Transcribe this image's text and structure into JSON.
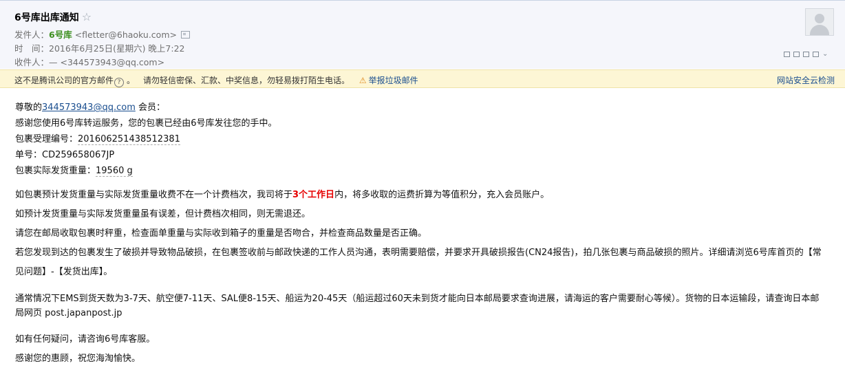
{
  "header": {
    "subject": "6号库出库通知",
    "star": "☆",
    "from_label": "发件人：",
    "from_name": "6号库",
    "from_email": "<fletter@6haoku.com>",
    "time_label": "时　间：",
    "time_value": "2016年6月25日(星期六) 晚上7:22",
    "to_label": "收件人：",
    "to_value": "— <344573943@qq.com>"
  },
  "warning": {
    "text": "这不是腾讯公司的官方邮件",
    "q_icon": "?",
    "tip": "请勿轻信密保、汇款、中奖信息，勿轻易拨打陌生电话。",
    "report_icon": "⚠",
    "report": "举报垃圾邮件",
    "cloud_check": "网站安全云检测"
  },
  "body": {
    "greet_prefix": "尊敬的",
    "greet_email": "344573943@qq.com",
    "greet_suffix": " 会员：",
    "thanks": "感谢您使用6号库转运服务，您的包裹已经由6号库发往您的手中。",
    "accept_label": "包裹受理编号：",
    "accept_no": "201606251438512381",
    "tracking_label": "单号：",
    "tracking_no": "CD259658067JP",
    "weight_label": "包裹实际发货重量：",
    "weight_value": "19560 g",
    "p1_a": "如包裹预计发货重量与实际发货重量收费不在一个计费档次，我司将于",
    "p1_emph": "3个工作日",
    "p1_b": "内，将多收取的运费折算为等值积分，充入会员账户。",
    "p2": "如预计发货重量与实际发货重量虽有误差，但计费档次相同，则无需退还。",
    "p3": "请您在邮局收取包裹时秤重，检查面单重量与实际收到箱子的重量是否吻合，并检查商品数量是否正确。",
    "p4": "若您发现到达的包裹发生了破损并导致物品破损，在包裹签收前与邮政快递的工作人员沟通，表明需要赔偿，并要求开具破损报告(CN24报告)，拍几张包裹与商品破损的照片。详细请浏览6号库首页的【常见问题】-【发货出库】。",
    "p5": "通常情况下EMS到货天数为3-7天、航空便7-11天、SAL便8-15天、船运为20-45天（船运超过60天未到货才能向日本邮局要求查询进展，请海运的客户需要耐心等候）。货物的日本运输段，请查询日本邮局网页 post.japanpost.jp",
    "p6": "如有任何疑问，请咨询6号库客服。",
    "p7": "感谢您的惠顾，祝您海淘愉快。"
  },
  "icons": [
    "star-icon",
    "contact-card-icon",
    "avatar-icon",
    "question-icon",
    "report-icon"
  ]
}
